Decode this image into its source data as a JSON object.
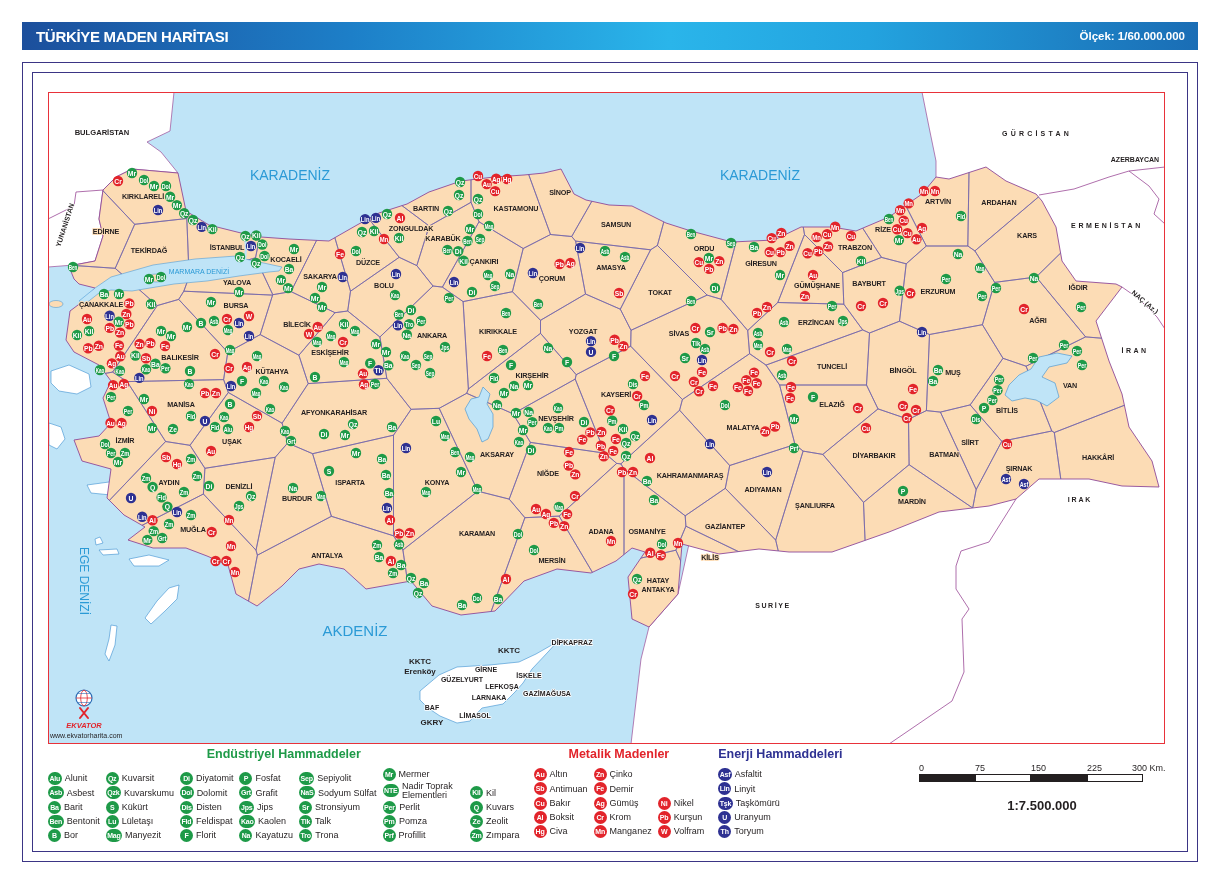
{
  "title_bar": {
    "title": "TÜRKİYE MADEN HARİTASI",
    "scale": "Ölçek: 1/60.000.000"
  },
  "map": {
    "seas": [
      "KARADENİZ",
      "KARADENİZ",
      "MARMARA DENİZİ",
      "EGE DENİZİ",
      "AKDENİZ"
    ],
    "countries": [
      "BULGARİSTAN",
      "YUNANİSTAN",
      "GÜRCİSTAN",
      "AZERBAYCAN",
      "ERMENİSTAN",
      "NAÇ (Az.)",
      "İRAN",
      "IRAK",
      "SURİYE"
    ],
    "provinces": [
      "KIRKLARELİ",
      "EDİRNE",
      "TEKİRDAĞ",
      "İSTANBUL",
      "KOCAELİ",
      "SAKARYA",
      "DÜZCE",
      "BOLU",
      "YALOVA",
      "ÇANAKKALE",
      "BURSA",
      "BİLECİK",
      "ESKİŞEHİR",
      "BALIKESİR",
      "KÜTAHYA",
      "MANİSA",
      "AFYONKARAHİSAR",
      "İZMİR",
      "UŞAK",
      "AYDIN",
      "DENİZLİ",
      "ISPARTA",
      "BURDUR",
      "MUĞLA",
      "ANTALYA",
      "BARTIN",
      "ZONGULDAK",
      "KARABÜK",
      "KASTAMONU",
      "SİNOP",
      "SAMSUN",
      "ÇANKIRI",
      "ÇORUM",
      "AMASYA",
      "ORDU",
      "GİRESUN",
      "TOKAT",
      "ANKARA",
      "KIRIKKALE",
      "YOZGAT",
      "SİVAS",
      "KIRŞEHİR",
      "KAYSERİ",
      "NEVŞEHİR",
      "AKSARAY",
      "MALATYA",
      "NİĞDE",
      "KONYA",
      "KAHRAMANMARAŞ",
      "ADIYAMAN",
      "KARAMAN",
      "ADANA",
      "OSMANİYE",
      "GAZİANTEP",
      "MERSİN",
      "KİLİS",
      "HATAY",
      "ARTVİN",
      "ARDAHAN",
      "RİZE",
      "TRABZON",
      "KARS",
      "GÜMÜŞHANE",
      "BAYBURT",
      "ERZURUM",
      "IĞDIR",
      "AĞRI",
      "ERZİNCAN",
      "TUNCELİ",
      "BİNGÖL",
      "MUŞ",
      "VAN",
      "ELAZIĞ",
      "BİTLİS",
      "SİİRT",
      "DİYARBAKIR",
      "BATMAN",
      "HAKKÂRİ",
      "ŞIRNAK",
      "ŞANLIURFA",
      "MARDİN"
    ],
    "city_labels": [
      "ANTAKYA"
    ],
    "cyprus_labels": [
      {
        "text": "KKTC",
        "kind": "region"
      },
      {
        "text": "DİPKAPRAZ",
        "kind": "town"
      },
      {
        "text": "KKTC",
        "kind": "region"
      },
      {
        "text": "Erenköy",
        "kind": "region"
      },
      {
        "text": "GİRNE",
        "kind": "town"
      },
      {
        "text": "GÜZELYURT",
        "kind": "town"
      },
      {
        "text": "İSKELE",
        "kind": "town"
      },
      {
        "text": "LEFKOŞA",
        "kind": "town"
      },
      {
        "text": "GAZİMAĞUSA",
        "kind": "town"
      },
      {
        "text": "LARNAKA",
        "kind": "town"
      },
      {
        "text": "BAF",
        "kind": "town"
      },
      {
        "text": "LİMASOL",
        "kind": "town"
      },
      {
        "text": "GKRY",
        "kind": "region"
      }
    ],
    "mineral_markers": [
      {
        "color": "#1e9a48",
        "codes": [
          "Mr",
          "Dol",
          "Mr",
          "Dol",
          "Mr",
          "Mr",
          "Qz",
          "Qz",
          "Kil",
          "Ben",
          "Qz",
          "Kil",
          "Dol",
          "Qz",
          "Qz",
          "Dol",
          "Mr",
          "Ba",
          "Dol",
          "Mr",
          "Mr",
          "Mr",
          "Mr",
          "Mr",
          "Kao",
          "Qz",
          "Qz",
          "Kil",
          "Kil",
          "Mr",
          "Dol",
          "Mr",
          "Ba",
          "Mr",
          "Kil",
          "Kil",
          "Mr",
          "Kil",
          "Kil",
          "Kao",
          "Kao",
          "Kao",
          "Ba",
          "Per",
          "B",
          "Mr",
          "Mr",
          "Mr",
          "Mr",
          "B",
          "Asb",
          "Mag",
          "Mag",
          "Mag",
          "Kao",
          "F",
          "Kao",
          "Mag",
          "Kao",
          "Kil",
          "Mag",
          "Mag",
          "Mag",
          "Mag",
          "Mr",
          "Mr",
          "F",
          "Ba",
          "B",
          "Per",
          "Ben",
          "Kao",
          "Per",
          "Mr",
          "Per",
          "Mr",
          "Ze",
          "Fld",
          "B",
          "Kao",
          "Fld",
          "Alu",
          "Kao",
          "Kao",
          "Grt",
          "Di",
          "Mr",
          "Qz",
          "Ba",
          "Dol",
          "Per",
          "Zm",
          "Mr",
          "Zm",
          "Zm",
          "Zm",
          "Q",
          "Zm",
          "Di",
          "Fld",
          "Q",
          "Zm",
          "Zm",
          "Zm",
          "Mr",
          "Grt",
          "Qz",
          "Jps",
          "Na",
          "Mag",
          "S",
          "Mr",
          "Ba",
          "Ba",
          "Ba",
          "Zm",
          "Asb",
          "Ba",
          "Ba",
          "Zm",
          "Qz",
          "Qz",
          "Qz",
          "Qz",
          "Dol",
          "Mr",
          "Mag",
          "Ben",
          "Sep",
          "Ben",
          "Di",
          "Kil",
          "Di",
          "Mag",
          "Sep",
          "Na",
          "Ben",
          "Asb",
          "Asb",
          "Ben",
          "Ben",
          "Sep",
          "Mr",
          "Di",
          "Ba",
          "Mr",
          "Di",
          "Tro",
          "Per",
          "Na",
          "Per",
          "Jps",
          "Sep",
          "Sep",
          "Sep",
          "Ben",
          "Ben",
          "F",
          "Fld",
          "Mr",
          "Na",
          "Mr",
          "Na",
          "F",
          "F",
          "Na",
          "Lu",
          "Mag",
          "Ben",
          "Mag",
          "Mr",
          "Mag",
          "Mag",
          "Mr",
          "Na",
          "Per",
          "Mr",
          "Kao",
          "Di",
          "Kao",
          "Kao",
          "Pm",
          "Dis",
          "Pm",
          "Di",
          "Pm",
          "Kil",
          "Qz",
          "Qz",
          "Qz",
          "Ba",
          "Ba",
          "Sr",
          "Tlk",
          "Asb",
          "Sr",
          "Dol",
          "Asb",
          "Asb",
          "Mag",
          "Mag",
          "Asb",
          "Mr",
          "Prf",
          "Mag",
          "Dol",
          "Dol",
          "Dol",
          "Qz",
          "Ba",
          "Dol",
          "Ba",
          "Qz",
          "Ba",
          "Qz",
          "Kil",
          "Per",
          "Jps",
          "Ben",
          "Mr",
          "Fld",
          "Na",
          "Mag",
          "Per",
          "Jps",
          "Na",
          "Per",
          "Per",
          "Per",
          "Per",
          "Per",
          "Ba",
          "Per",
          "Per",
          "Ba",
          "Per",
          "Per",
          "P",
          "Per",
          "Dis",
          "F",
          "P"
        ]
      },
      {
        "color": "#e2242b",
        "codes": [
          "Cr",
          "Fe",
          "Al",
          "Mn",
          "Pb",
          "Au",
          "Zn",
          "Pb",
          "Pb",
          "Zn",
          "Pb",
          "Zn",
          "Fe",
          "Zn",
          "Pb",
          "Fe",
          "Ag",
          "Au",
          "Sb",
          "Au",
          "Ag",
          "Cr",
          "W",
          "Cr",
          "Cr",
          "Ag",
          "W",
          "Au",
          "Cr",
          "Au",
          "Ag",
          "Ni",
          "Au",
          "Ag",
          "Pb",
          "Zn",
          "Sb",
          "Hg",
          "Sb",
          "Hg",
          "Au",
          "Al",
          "Cr",
          "Mn",
          "Cr",
          "Cr",
          "Mn",
          "Mn",
          "Al",
          "Pb",
          "Al",
          "Cu",
          "Au",
          "Ag",
          "Hg",
          "Cu",
          "Pb",
          "Ag",
          "Sb",
          "Cu",
          "Pb",
          "Zn",
          "Cu",
          "Zn",
          "Cu",
          "Pb",
          "Zn",
          "Fe",
          "Pb",
          "Zn",
          "Fe",
          "Pb",
          "Zn",
          "Cr",
          "Fe",
          "Cr",
          "Fe",
          "Pb",
          "Zn",
          "Pb",
          "Fe",
          "Zn",
          "Fe",
          "Pb",
          "Zn",
          "Al",
          "Cr",
          "Pb",
          "Zn",
          "Cr",
          "Fe",
          "Cr",
          "Cr",
          "Fe",
          "Pb",
          "Zn",
          "Cr",
          "Fe",
          "Fe",
          "Fe",
          "Fe",
          "Fe",
          "Fe",
          "Fe",
          "Zn",
          "Pb",
          "Au",
          "Ag",
          "Fe",
          "Cr",
          "Pb",
          "Zn",
          "Mn",
          "Mn",
          "Al",
          "Fe",
          "Cr",
          "Al",
          "Zn",
          "Mn",
          "Mn",
          "Cu",
          "Cu",
          "Cu",
          "Pb",
          "Zn",
          "Au",
          "Zn",
          "Cr",
          "Cr",
          "Mn",
          "Mn",
          "Mn",
          "Mn",
          "Cu",
          "Cu",
          "Cu",
          "Au",
          "Ag",
          "Cr",
          "Cr",
          "Fe",
          "Cr",
          "Cr",
          "Cr",
          "Cr",
          "Cu",
          "Cu",
          "Cr"
        ]
      },
      {
        "color": "#2e3192",
        "codes": [
          "Lin",
          "Lin",
          "Lin",
          "Lin",
          "Lin",
          "Lin",
          "Lin",
          "Lin",
          "Lin",
          "Lin",
          "Lin",
          "Lin",
          "Th",
          "Lin",
          "U",
          "U",
          "Lin",
          "Lin",
          "Lin",
          "Lin",
          "Lin",
          "Lin",
          "Lin",
          "Lin",
          "U",
          "Lin",
          "Lin",
          "Lin",
          "Lin",
          "Lin",
          "Asf",
          "Asf"
        ]
      }
    ],
    "logo": {
      "name": "EKVATOR",
      "url": "www.ekvatorharita.com"
    }
  },
  "legend": [
    {
      "title": "Endüstriyel Hammaddeler",
      "color": "#1e9a48",
      "columns": [
        [
          {
            "code": "Alu",
            "name": "Alunit"
          },
          {
            "code": "Asb",
            "name": "Asbest"
          },
          {
            "code": "Ba",
            "name": "Barit"
          },
          {
            "code": "Ben",
            "name": "Bentonit"
          },
          {
            "code": "B",
            "name": "Bor"
          }
        ],
        [
          {
            "code": "Qz",
            "name": "Kuvarsit"
          },
          {
            "code": "Qzk",
            "name": "Kuvarskumu"
          },
          {
            "code": "S",
            "name": "Kükürt"
          },
          {
            "code": "Lu",
            "name": "Lületaşı"
          },
          {
            "code": "Mag",
            "name": "Manyezit"
          }
        ],
        [
          {
            "code": "Di",
            "name": "Diyatomit"
          },
          {
            "code": "Dol",
            "name": "Dolomit"
          },
          {
            "code": "Dis",
            "name": "Disten"
          },
          {
            "code": "Fld",
            "name": "Feldispat"
          },
          {
            "code": "F",
            "name": "Florit"
          }
        ],
        [
          {
            "code": "P",
            "name": "Fosfat"
          },
          {
            "code": "Grt",
            "name": "Grafit"
          },
          {
            "code": "Jps",
            "name": "Jips"
          },
          {
            "code": "Kao",
            "name": "Kaolen"
          },
          {
            "code": "Na",
            "name": "Kayatuzu"
          }
        ],
        [
          {
            "code": "Sep",
            "name": "Sepiyolit"
          },
          {
            "code": "NaS",
            "name": "Sodyum Sülfat"
          },
          {
            "code": "Sr",
            "name": "Stronsiyum"
          },
          {
            "code": "Tlk",
            "name": "Talk"
          },
          {
            "code": "Tro",
            "name": "Trona"
          }
        ],
        [
          {
            "code": "Mr",
            "name": "Mermer"
          },
          {
            "code": "NTE",
            "name": "Nadir Toprak Elementleri"
          },
          {
            "code": "Per",
            "name": "Perlit"
          },
          {
            "code": "Pm",
            "name": "Pomza"
          },
          {
            "code": "Prf",
            "name": "Profillit"
          }
        ],
        [
          {
            "code": "Kil",
            "name": "Kil"
          },
          {
            "code": "Q",
            "name": "Kuvars"
          },
          {
            "code": "Ze",
            "name": "Zeolit"
          },
          {
            "code": "Zm",
            "name": "Zımpara"
          }
        ]
      ]
    },
    {
      "title": "Metalik Madenler",
      "color": "#e2242b",
      "columns": [
        [
          {
            "code": "Au",
            "name": "Altın"
          },
          {
            "code": "Sb",
            "name": "Antimuan"
          },
          {
            "code": "Cu",
            "name": "Bakır"
          },
          {
            "code": "Al",
            "name": "Boksit"
          },
          {
            "code": "Hg",
            "name": "Civa"
          }
        ],
        [
          {
            "code": "Zn",
            "name": "Çinko"
          },
          {
            "code": "Fe",
            "name": "Demir"
          },
          {
            "code": "Ag",
            "name": "Gümüş"
          },
          {
            "code": "Cr",
            "name": "Krom"
          },
          {
            "code": "Mn",
            "name": "Manganez"
          }
        ],
        [
          {
            "code": "Ni",
            "name": "Nikel"
          },
          {
            "code": "Pb",
            "name": "Kurşun"
          },
          {
            "code": "W",
            "name": "Volfram"
          }
        ]
      ]
    },
    {
      "title": "Enerji Hammaddeleri",
      "color": "#2e3192",
      "columns": [
        [
          {
            "code": "Asf",
            "name": "Asfaltit"
          },
          {
            "code": "Lin",
            "name": "Linyit"
          },
          {
            "code": "Tşk",
            "name": "Taşkömürü"
          },
          {
            "code": "U",
            "name": "Uranyum"
          },
          {
            "code": "Th",
            "name": "Toryum"
          }
        ]
      ]
    }
  ],
  "scale_bar": {
    "ticks": [
      "0",
      "75",
      "150",
      "225",
      "300 Km."
    ],
    "ratio": "1:7.500.000"
  }
}
